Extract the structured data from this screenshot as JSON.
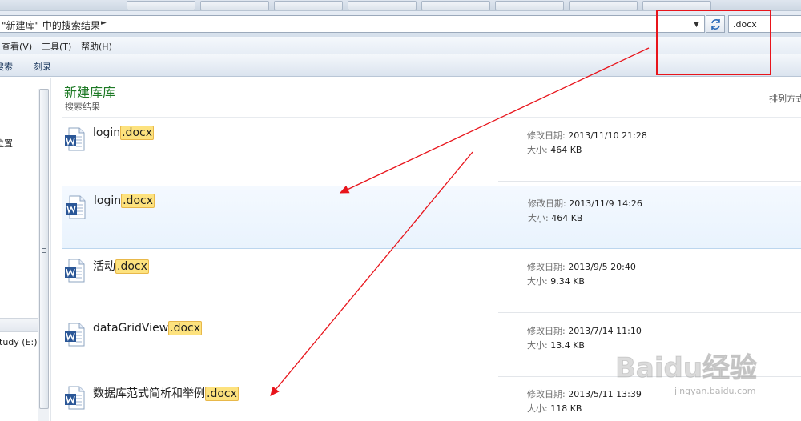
{
  "address_bar": {
    "breadcrumb": "\"新建库\" 中的搜索结果",
    "search_value": ".docx"
  },
  "menu": [
    "查看(V)",
    "工具(T)",
    "帮助(H)"
  ],
  "toolbar": [
    "搜索",
    "刻录"
  ],
  "nav": {
    "item_location": "位置",
    "item_drive": "tudy (E:)"
  },
  "library": {
    "title": "新建库库",
    "subtitle": "搜索结果",
    "arrange_label": "排列方式"
  },
  "meta_labels": {
    "date": "修改日期:",
    "size": "大小:"
  },
  "files": [
    {
      "name_prefix": "login",
      "name_ext": ".docx",
      "modified": "2013/11/10 21:28",
      "size": "464 KB"
    },
    {
      "name_prefix": "login",
      "name_ext": ".docx",
      "modified": "2013/11/9 14:26",
      "size": "464 KB"
    },
    {
      "name_prefix": "活动",
      "name_ext": ".docx",
      "modified": "2013/9/5 20:40",
      "size": "9.34 KB"
    },
    {
      "name_prefix": "dataGridView",
      "name_ext": ".docx",
      "modified": "2013/7/14 11:10",
      "size": "13.4 KB"
    },
    {
      "name_prefix": "数据库范式简析和举例",
      "name_ext": ".docx",
      "modified": "2013/5/11 13:39",
      "size": "118 KB"
    }
  ],
  "selected_index": 1,
  "icons": {
    "refresh": "refresh-icon",
    "doc": "word-document-icon",
    "dropdown": "chevron-down-icon",
    "breadcrumb_arrow": "chevron-right-icon"
  },
  "colors": {
    "library_title": "#1e7a26",
    "highlight": "#fde27e",
    "annotation": "#e8141b",
    "word_blue": "#2b5797"
  },
  "watermark": {
    "brand": "Baidu经验",
    "url": "jingyan.baidu.com"
  }
}
